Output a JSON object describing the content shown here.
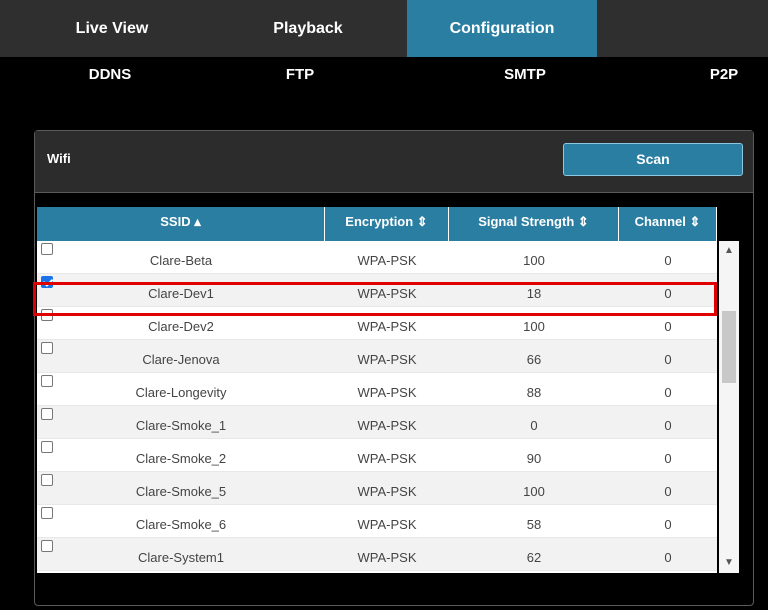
{
  "topnav": {
    "tabs": [
      "Live View",
      "Playback",
      "Configuration"
    ]
  },
  "subnav": {
    "items": [
      "DDNS",
      "FTP",
      "SMTP",
      "P2P"
    ]
  },
  "panel": {
    "title": "Wifi",
    "scan_label": "Scan"
  },
  "table": {
    "headers": {
      "ssid": "SSID ▴",
      "encryption": "Encryption ⇕",
      "signal": "Signal Strength ⇕",
      "channel": "Channel ⇕"
    },
    "rows": [
      {
        "ssid": "Clare-Beta",
        "encryption": "WPA-PSK",
        "signal": "100",
        "channel": "0",
        "checked": false
      },
      {
        "ssid": "Clare-Dev1",
        "encryption": "WPA-PSK",
        "signal": "18",
        "channel": "0",
        "checked": true
      },
      {
        "ssid": "Clare-Dev2",
        "encryption": "WPA-PSK",
        "signal": "100",
        "channel": "0",
        "checked": false
      },
      {
        "ssid": "Clare-Jenova",
        "encryption": "WPA-PSK",
        "signal": "66",
        "channel": "0",
        "checked": false
      },
      {
        "ssid": "Clare-Longevity",
        "encryption": "WPA-PSK",
        "signal": "88",
        "channel": "0",
        "checked": false
      },
      {
        "ssid": "Clare-Smoke_1",
        "encryption": "WPA-PSK",
        "signal": "0",
        "channel": "0",
        "checked": false
      },
      {
        "ssid": "Clare-Smoke_2",
        "encryption": "WPA-PSK",
        "signal": "90",
        "channel": "0",
        "checked": false
      },
      {
        "ssid": "Clare-Smoke_5",
        "encryption": "WPA-PSK",
        "signal": "100",
        "channel": "0",
        "checked": false
      },
      {
        "ssid": "Clare-Smoke_6",
        "encryption": "WPA-PSK",
        "signal": "58",
        "channel": "0",
        "checked": false
      },
      {
        "ssid": "Clare-System1",
        "encryption": "WPA-PSK",
        "signal": "62",
        "channel": "0",
        "checked": false
      }
    ]
  },
  "scrollbar": {
    "up_icon": "arrow-up-icon",
    "down_icon": "arrow-down-icon"
  },
  "colors": {
    "accent": "#2a7ea2",
    "highlight": "#e00000",
    "checkbox_checked": "#1a73e8"
  }
}
